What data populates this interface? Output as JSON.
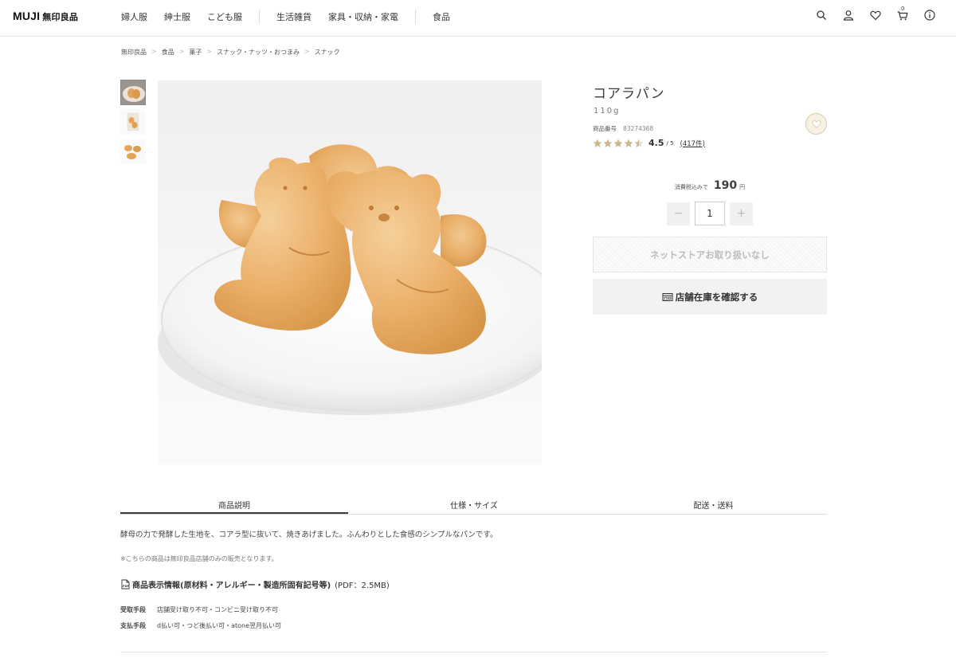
{
  "header": {
    "logo_en": "MUJI",
    "logo_jp": "無印良品",
    "nav": [
      "婦人服",
      "紳士服",
      "こども服",
      "生活雑貨",
      "家具・収納・家電",
      "食品"
    ],
    "cart_count": "0",
    "icons": [
      "search-icon",
      "user-icon",
      "heart-icon",
      "cart-icon",
      "info-icon"
    ]
  },
  "breadcrumb": [
    "無印良品",
    "食品",
    "菓子",
    "スナック・ナッツ・おつまみ",
    "スナック"
  ],
  "product": {
    "name": "コアラパン",
    "weight": "110g",
    "code_label": "商品番号",
    "code": "83274368",
    "rating": {
      "stars": 4.5,
      "score": "4.5",
      "out_of": "/ 5",
      "count": "(417件)"
    },
    "price_label": "消費税込みで",
    "price": "190",
    "currency": "円",
    "quantity": "1",
    "unavailable_label": "ネットストアお取り扱いなし",
    "store_check_label": "店舗在庫を確認する"
  },
  "tabs": [
    "商品説明",
    "仕様・サイズ",
    "配送・送料"
  ],
  "details": {
    "description": "酵母の力で発酵した生地を、コアラ型に抜いて、焼きあげました。ふんわりとした食感のシンプルなパンです。",
    "note": "※こちらの商品は無印良品店舗のみの販売となります。",
    "info_link": "商品表示情報(原材料・アレルギー・製造所固有記号等)",
    "info_pdf": "(PDF：2.5MB)",
    "receive_label": "受取手段",
    "receive_value": "店舗受け取り不可・コンビニ受け取り不可",
    "payment_label": "支払手段",
    "payment_value": "d払い可・つど後払い可・atone翌月払い可"
  },
  "colors": {
    "text": "#3c3c43",
    "star": "#c9b98a",
    "border": "#e5e5e5"
  }
}
